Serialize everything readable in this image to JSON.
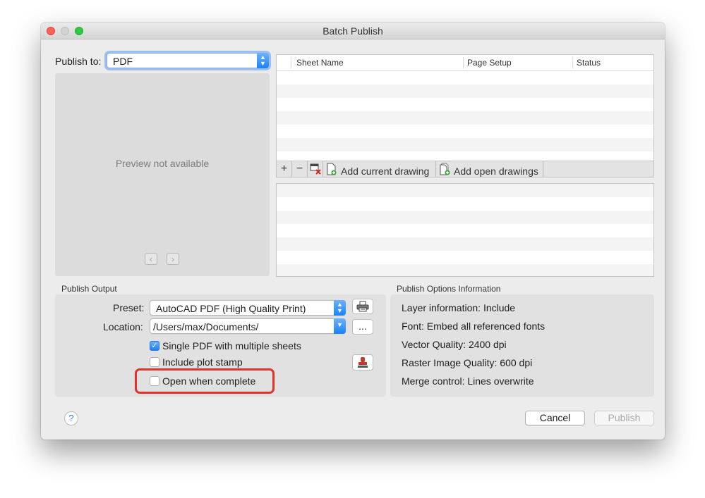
{
  "window": {
    "title": "Batch Publish"
  },
  "publish_to": {
    "label": "Publish to:",
    "value": "PDF"
  },
  "preview": {
    "message": "Preview not available"
  },
  "sheet_table": {
    "columns": [
      "Sheet Name",
      "Page Setup",
      "Status"
    ],
    "rows": []
  },
  "toolbar": {
    "add_current_label": "Add current drawing",
    "add_open_label": "Add open drawings"
  },
  "publish_output": {
    "title": "Publish Output",
    "preset_label": "Preset:",
    "preset_value": "AutoCAD PDF (High Quality Print)",
    "location_label": "Location:",
    "location_value": "/Users/max/Documents/",
    "browse_label": "...",
    "single_pdf": {
      "label": "Single PDF with multiple sheets",
      "checked": true
    },
    "plot_stamp": {
      "label": "Include plot stamp",
      "checked": false
    },
    "open_when_complete": {
      "label": "Open when complete",
      "checked": false
    }
  },
  "publish_options": {
    "title": "Publish Options Information",
    "items": [
      {
        "label": "Layer information:",
        "value": "Include"
      },
      {
        "label": "Font:",
        "value": "Embed all referenced fonts"
      },
      {
        "label": "Vector Quality:",
        "value": "2400 dpi"
      },
      {
        "label": "Raster Image Quality:",
        "value": "600 dpi"
      },
      {
        "label": "Merge control:",
        "value": "Lines overwrite"
      }
    ]
  },
  "footer": {
    "help_label": "?",
    "cancel_label": "Cancel",
    "publish_label": "Publish"
  },
  "colors": {
    "accent": "#1a82fb",
    "highlight": "#e0312a"
  }
}
